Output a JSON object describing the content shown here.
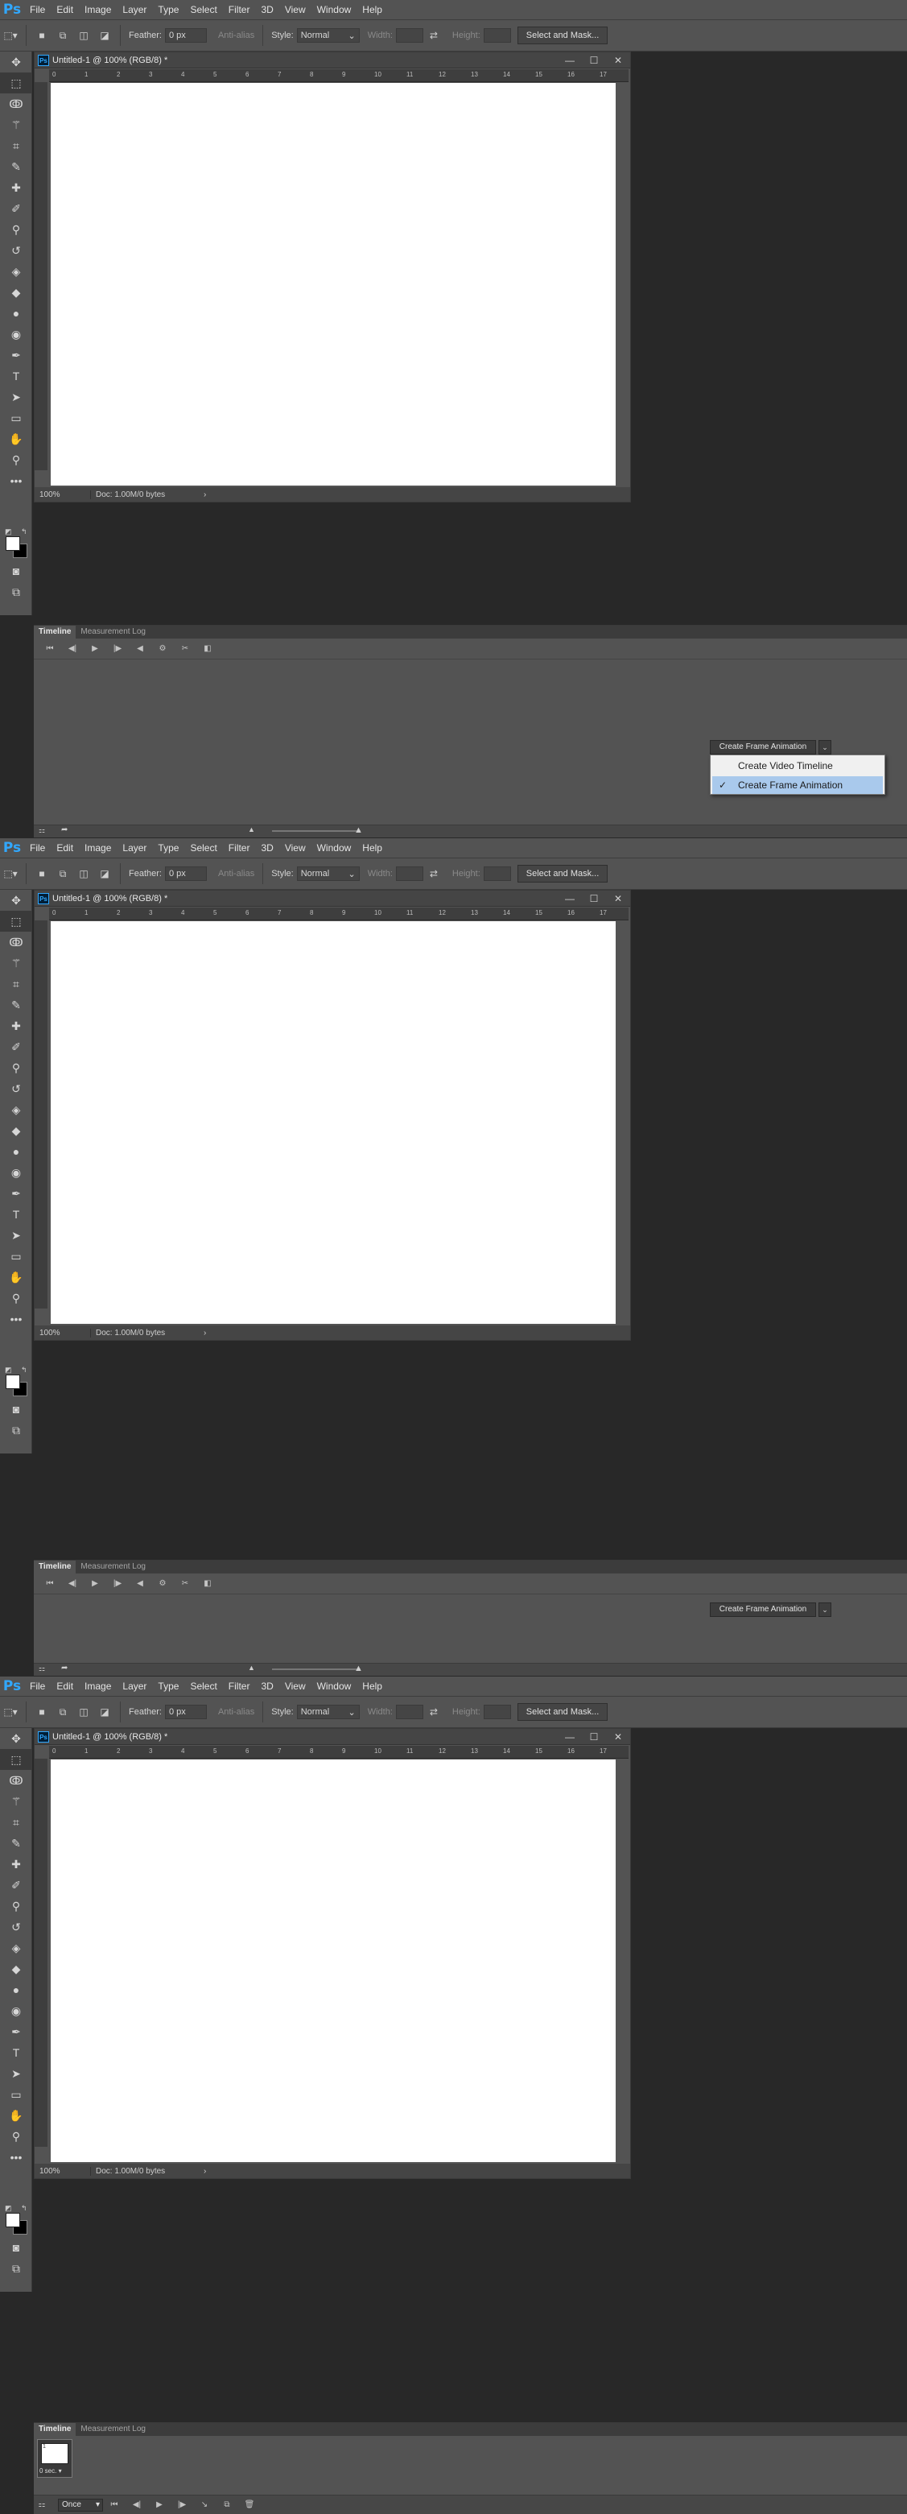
{
  "app": {
    "logo": "Ps",
    "colors": {
      "menubar": "#535353",
      "accent": "#31a8ff",
      "selection": "#a9c9ec"
    }
  },
  "menu": [
    "File",
    "Edit",
    "Image",
    "Layer",
    "Type",
    "Select",
    "Filter",
    "3D",
    "View",
    "Window",
    "Help"
  ],
  "options": {
    "feather_label": "Feather:",
    "feather_value": "0 px",
    "anti_alias_label": "Anti-alias",
    "style_label": "Style:",
    "style_value": "Normal",
    "width_label": "Width:",
    "height_label": "Height:",
    "select_mask_label": "Select and Mask..."
  },
  "tools": [
    "move-icon",
    "marquee-icon",
    "lasso-icon",
    "magic-wand-icon",
    "crop-icon",
    "eyedropper-icon",
    "healing-icon",
    "brush-icon",
    "stamp-icon",
    "history-brush-icon",
    "eraser-icon",
    "paint-bucket-icon",
    "blur-icon",
    "dodge-icon",
    "pen-icon",
    "type-icon",
    "path-select-icon",
    "rectangle-icon",
    "hand-icon",
    "zoom-icon",
    "more-icon"
  ],
  "document": {
    "title": "Untitled-1 @ 100% (RGB/8) *",
    "zoom": "100%",
    "doc_info": "Doc: 1.00M/0 bytes",
    "ruler_numbers": [
      "0",
      "1",
      "2",
      "3",
      "4",
      "5",
      "6",
      "7",
      "8",
      "9",
      "10",
      "11",
      "12",
      "13",
      "14",
      "15",
      "16",
      "17"
    ]
  },
  "timeline": {
    "tab_timeline": "Timeline",
    "tab_measurement": "Measurement Log",
    "create_button": "Create Frame Animation",
    "dropdown_items": [
      "Create Video Timeline",
      "Create Frame Animation"
    ],
    "dropdown_selected_index": 1,
    "frame_duration": "0 sec.",
    "frame_number": "1",
    "loop_value": "Once"
  }
}
